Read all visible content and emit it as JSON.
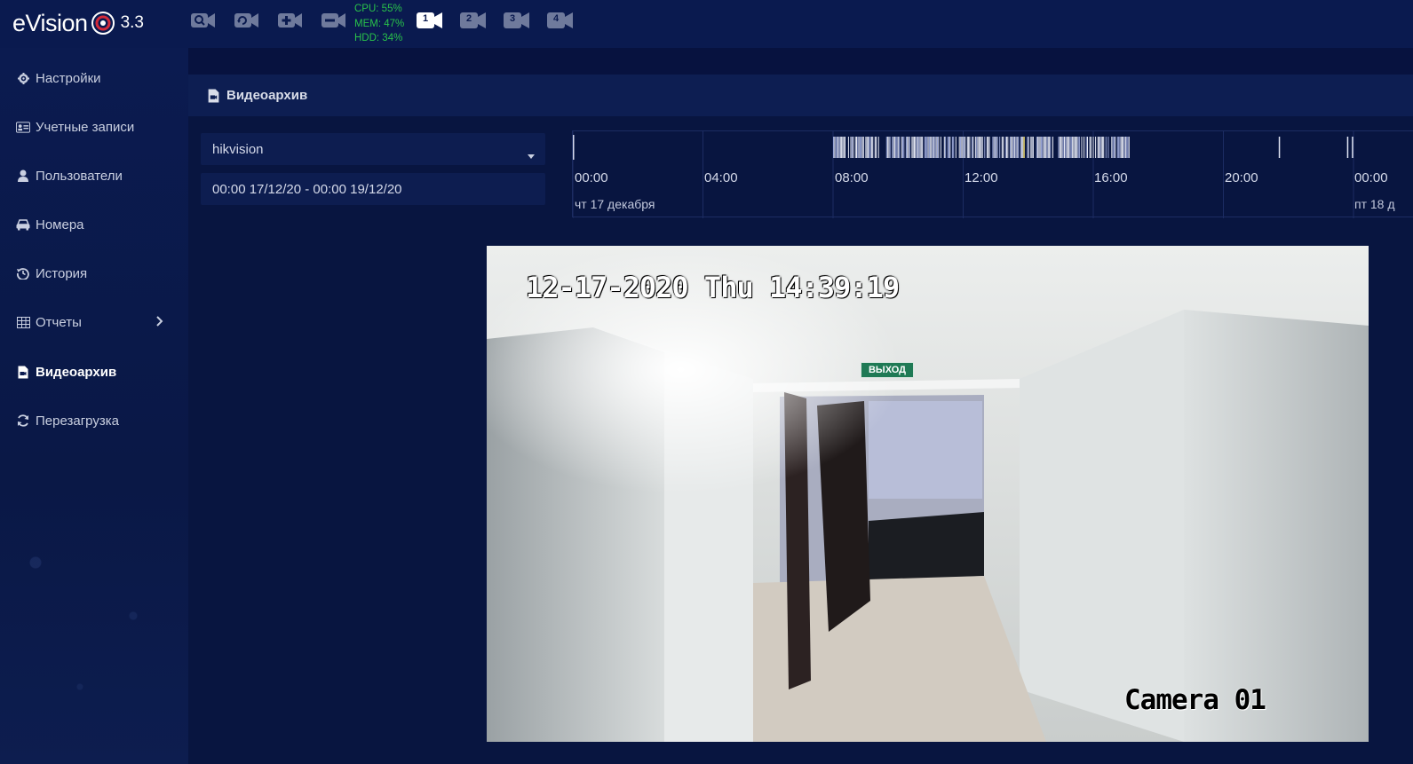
{
  "app": {
    "name": "eVision",
    "version": "3.3"
  },
  "toolbar": {
    "icons": [
      "camera-search-icon",
      "camera-refresh-icon",
      "camera-add-icon",
      "camera-off-icon"
    ],
    "stats": {
      "cpu": "CPU: 55%",
      "mem": "MEM: 47%",
      "hdd": "HDD: 34%"
    },
    "cameras": [
      {
        "label": "1",
        "active": true
      },
      {
        "label": "2",
        "active": false
      },
      {
        "label": "3",
        "active": false
      },
      {
        "label": "4",
        "active": false
      }
    ]
  },
  "sidebar": {
    "items": [
      {
        "label": "Настройки",
        "icon": "gear-icon"
      },
      {
        "label": "Учетные записи",
        "icon": "id-card-icon"
      },
      {
        "label": "Пользователи",
        "icon": "user-icon"
      },
      {
        "label": "Номера",
        "icon": "car-icon"
      },
      {
        "label": "История",
        "icon": "history-icon"
      },
      {
        "label": "Отчеты",
        "icon": "table-icon",
        "has_submenu": true
      },
      {
        "label": "Видеоархив",
        "icon": "file-video-icon",
        "active": true
      },
      {
        "label": "Перезагрузка",
        "icon": "refresh-icon"
      }
    ]
  },
  "main": {
    "title": "Видеоархив",
    "camera_select": {
      "value": "hikvision"
    },
    "date_range": "00:00 17/12/20 - 00:00 19/12/20",
    "timeline": {
      "ticks": [
        "00:00",
        "04:00",
        "08:00",
        "12:00",
        "16:00",
        "20:00",
        "00:00"
      ],
      "days": [
        "чт 17 декабря",
        "пт 18 д"
      ]
    },
    "video": {
      "osd_time": "12-17-2020 Thu 14:39:19",
      "osd_camera": "Camera 01",
      "sign": "ВЫХОД"
    }
  },
  "colors": {
    "background": "#07123f",
    "topbar": "#0a1a4f",
    "stats_green": "#29c24a",
    "panel_header": "#0d1e52"
  }
}
